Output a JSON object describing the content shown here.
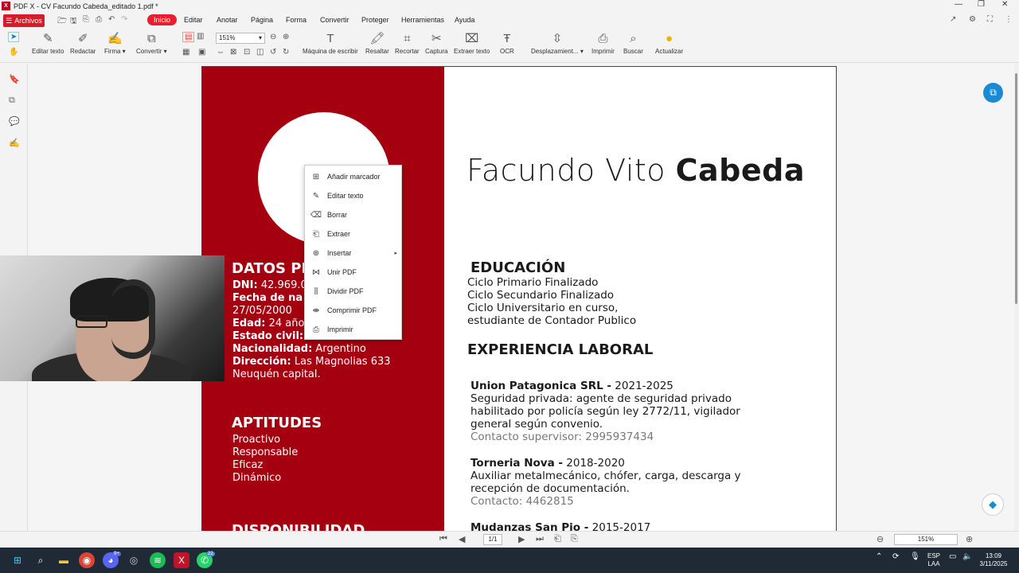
{
  "window": {
    "title": "PDF X - CV Facundo Cabeda_editado 1.pdf *"
  },
  "menubar": {
    "archivos": "Archivos",
    "items": [
      "Inicio",
      "Editar",
      "Anotar",
      "Página",
      "Forma",
      "Convertir",
      "Proteger",
      "Herramientas",
      "Ayuda"
    ]
  },
  "ribbon": {
    "editar_texto": "Editar texto",
    "redactar": "Redactar",
    "firma": "Firma",
    "convertir": "Convertir",
    "zoom": "151%",
    "maquina": "Máquina de escribir",
    "resaltar": "Resaltar",
    "recortar": "Recortar",
    "captura": "Captura",
    "extraer_texto": "Extraer texto",
    "ocr": "OCR",
    "desplazamiento": "Desplazamient...",
    "imprimir": "Imprimir",
    "buscar": "Buscar",
    "actualizar": "Actualizar"
  },
  "context_menu": {
    "items": [
      "Añadir marcador",
      "Editar texto",
      "Borrar",
      "Extraer",
      "Insertar",
      "Unir PDF",
      "Dividir PDF",
      "Comprimir PDF",
      "Imprimir"
    ]
  },
  "cv": {
    "name_first": "Facundo Vito ",
    "name_last": "Cabeda",
    "datos_heading": "DATOS PE",
    "dni_label": "DNI:",
    "dni_value": " 42.969.0",
    "fecha_label": "Fecha de na",
    "fecha_value": "27/05/2000",
    "edad_label": "Edad:",
    "edad_value": " 24 año",
    "estado_label": "Estado civil:",
    "nacionalidad_label": "Nacionalidad:",
    "nacionalidad_value": " Argentino",
    "direccion_label": "Dirección:",
    "direccion_value": " Las Magnolias 633",
    "direccion_city": "Neuquén capital.",
    "aptitudes_heading": "APTITUDES",
    "aptitudes": [
      "Proactivo",
      "Responsable",
      "Eficaz",
      "Dinámico"
    ],
    "disponibilidad_heading": "DISPONIBILIDAD",
    "educacion_heading": "EDUCACIÓN",
    "educacion": [
      "Ciclo Primario Finalizado",
      "Ciclo Secundario Finalizado",
      "Ciclo Universitario en curso,",
      "estudiante de Contador Publico"
    ],
    "experiencia_heading": "EXPERIENCIA LABORAL",
    "job1_company": "Union Patagonica SRL -",
    "job1_years": " 2021-2025",
    "job1_desc": [
      "Seguridad privada: agente de seguridad privado",
      "habilitado por policía según ley 2772/11, vigilador",
      "general según convenio."
    ],
    "job1_contact": "Contacto supervisor: 2995937434",
    "job2_company": "Torneria Nova -",
    "job2_years": " 2018-2020",
    "job2_desc": [
      "Auxiliar metalmecánico, chófer, carga, descarga y",
      "recepción de documentación."
    ],
    "job2_contact": "Contacto: 4462815",
    "job3_company": "Mudanzas San Pio -",
    "job3_years": " 2015-2017"
  },
  "statusbar": {
    "page": "1/1",
    "zoom": "151%"
  },
  "taskbar": {
    "lang": "ESP",
    "lang2": "LAA",
    "time": "13:09",
    "date": "3/11/2025",
    "discord_badge": "9+",
    "whatsapp_badge": "22"
  }
}
